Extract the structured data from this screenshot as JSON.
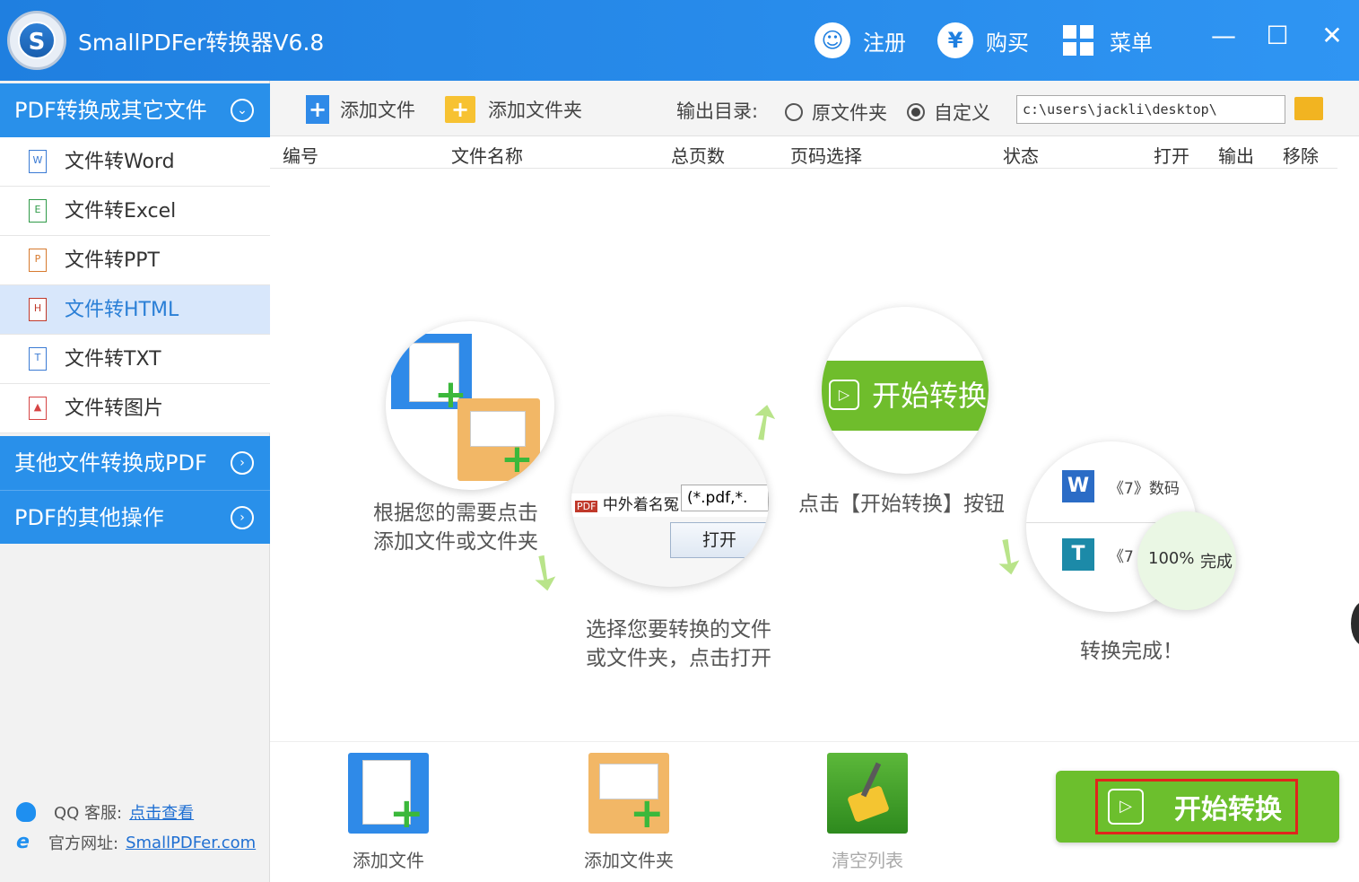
{
  "titlebar": {
    "app_title": "SmallPDFer转换器V6.8",
    "register_label": "注册",
    "buy_label": "购买",
    "menu_label": "菜单",
    "minimize": "—",
    "maximize": "☐",
    "close": "✕"
  },
  "sidebar": {
    "categories": [
      {
        "label": "PDF转换成其它文件",
        "expanded": true
      },
      {
        "label": "其他文件转换成PDF",
        "expanded": false
      },
      {
        "label": "PDF的其他操作",
        "expanded": false
      }
    ],
    "items": [
      {
        "label": "文件转Word",
        "icon": "word-file-icon"
      },
      {
        "label": "文件转Excel",
        "icon": "excel-file-icon"
      },
      {
        "label": "文件转PPT",
        "icon": "ppt-file-icon"
      },
      {
        "label": "文件转HTML",
        "icon": "html-file-icon",
        "selected": true
      },
      {
        "label": "文件转TXT",
        "icon": "txt-file-icon"
      },
      {
        "label": "文件转图片",
        "icon": "image-file-icon"
      }
    ],
    "support": {
      "qq_label": "QQ 客服:",
      "qq_link": "点击查看",
      "site_label": "官方网址:",
      "site_link": "SmallPDFer.com"
    }
  },
  "toolbar": {
    "add_file": "添加文件",
    "add_folder": "添加文件夹",
    "output_dir_label": "输出目录:",
    "radio_original": "原文件夹",
    "radio_custom": "自定义",
    "selected_radio": "自定义",
    "output_path": "c:\\users\\jackli\\desktop\\"
  },
  "table": {
    "columns": [
      "编号",
      "文件名称",
      "总页数",
      "页码选择",
      "状态",
      "打开",
      "输出",
      "移除"
    ]
  },
  "guide": {
    "step1": [
      "根据您的需要点击",
      "添加文件或文件夹"
    ],
    "step2": [
      "选择您要转换的文件",
      "或文件夹，点击打开"
    ],
    "step2_file": "中外着名冤",
    "step2_filter": "(*.pdf,*.",
    "step2_open": "打开",
    "step2_pdf_tag": "PDF",
    "step3": "点击【开始转换】按钮",
    "step3_button": "开始转换",
    "step4": "转换完成！",
    "step4_row1": "《7》数码",
    "step4_row2": "《7",
    "step4_progress": "100%",
    "step4_done": "完成"
  },
  "bottom": {
    "add_file": "添加文件",
    "add_folder": "添加文件夹",
    "clear_list": "清空列表",
    "start": "开始转换"
  },
  "colors": {
    "title_blue": "#1f7fe0",
    "sidebar_blue": "#2990ea",
    "start_green": "#6cbf2d",
    "highlight_red": "#e0251c"
  }
}
